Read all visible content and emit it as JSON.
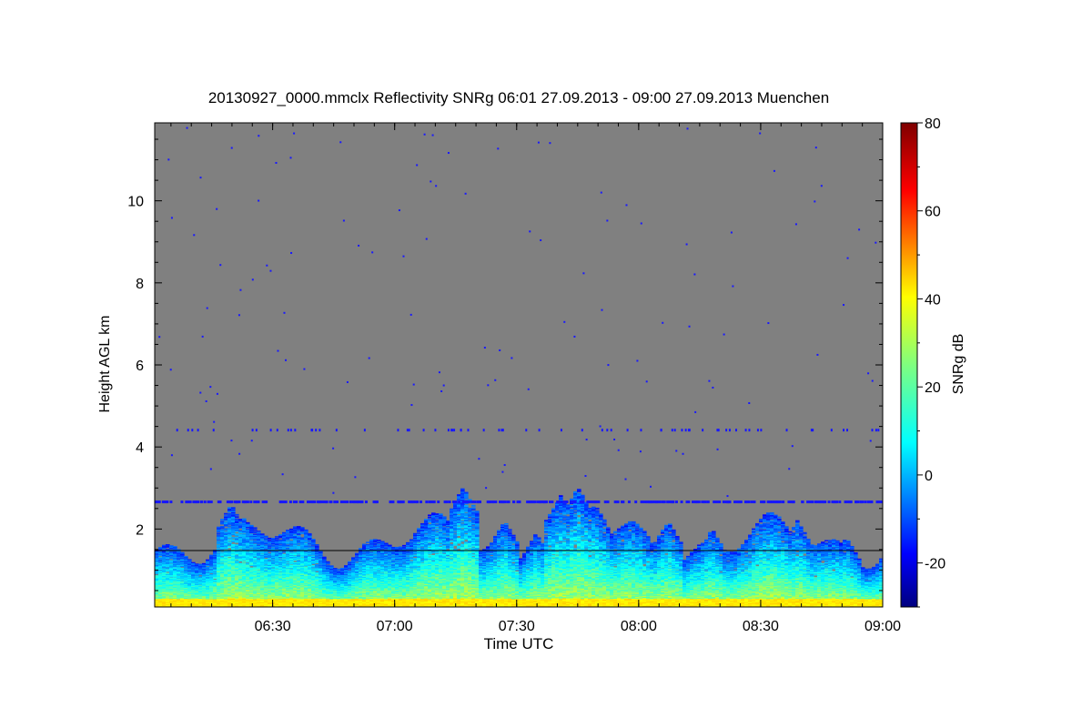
{
  "chart_data": {
    "type": "heatmap",
    "title": "20130927_0000.mmclx Reflectivity SNRg   06:01 27.09.2013 - 09:00 27.09.2013 Muenchen",
    "xlabel": "Time UTC",
    "ylabel": "Height AGL km",
    "colorbar_label": "SNRg dB",
    "x_range": [
      "06:01",
      "09:00"
    ],
    "x_ticks": [
      "06:30",
      "07:00",
      "07:30",
      "08:00",
      "08:30",
      "09:00"
    ],
    "ylim": [
      0.1,
      11.9
    ],
    "y_ticks": [
      2,
      4,
      6,
      8,
      10
    ],
    "colorbar_range": [
      -30,
      80
    ],
    "colorbar_ticks": [
      -20,
      0,
      20,
      40,
      60,
      80
    ],
    "colormap": "jet",
    "missing_color": "#808080",
    "echo_features": [
      {
        "name": "cloud layer top",
        "height_km": 2.65
      },
      {
        "name": "reference line",
        "height_km": 1.5
      },
      {
        "name": "sparse noise line",
        "height_km": 4.4
      }
    ]
  }
}
